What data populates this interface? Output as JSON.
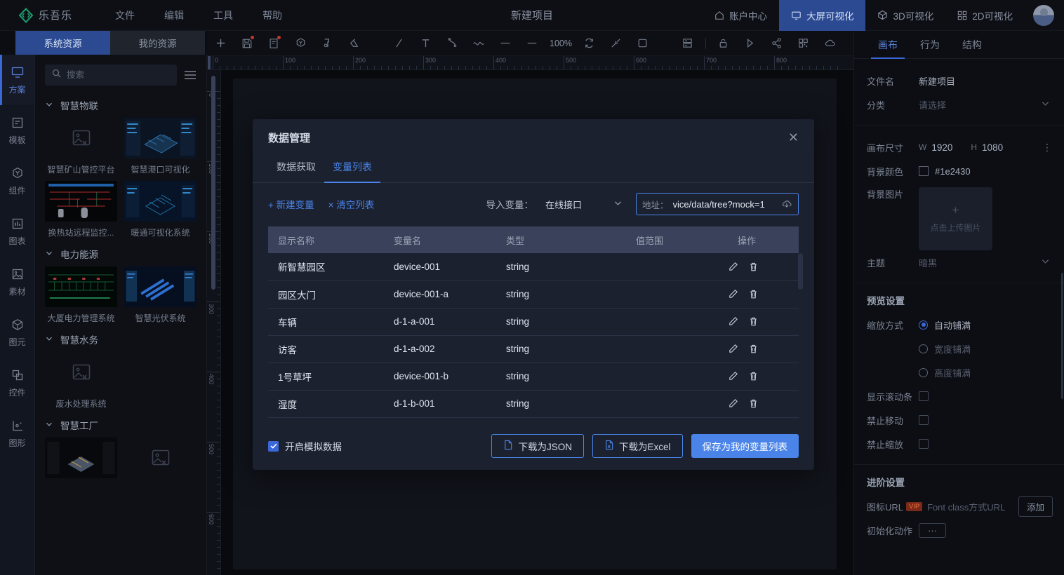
{
  "topbar": {
    "brand": "乐吾乐",
    "menu": [
      "文件",
      "编辑",
      "工具",
      "帮助"
    ],
    "project_title": "新建项目",
    "right_items": [
      {
        "label": "账户中心",
        "icon": "home-icon",
        "active": false
      },
      {
        "label": "大屏可视化",
        "icon": "monitor-icon",
        "active": true
      },
      {
        "label": "3D可视化",
        "icon": "cube-icon",
        "active": false
      },
      {
        "label": "2D可视化",
        "icon": "grid-icon",
        "active": false
      }
    ],
    "accent": "#2b4a92"
  },
  "left": {
    "tabs": [
      {
        "label": "系统资源",
        "active": true
      },
      {
        "label": "我的资源",
        "active": false
      }
    ],
    "rail": [
      {
        "label": "方案",
        "icon": "monitor-icon",
        "active": true
      },
      {
        "label": "模板",
        "icon": "template-icon",
        "active": false
      },
      {
        "label": "组件",
        "icon": "component-icon",
        "active": false
      },
      {
        "label": "图表",
        "icon": "chart-icon",
        "active": false
      },
      {
        "label": "素材",
        "icon": "image-icon",
        "active": false
      },
      {
        "label": "图元",
        "icon": "cube-icon",
        "active": false
      },
      {
        "label": "控件",
        "icon": "widget-icon",
        "active": false
      },
      {
        "label": "图形",
        "icon": "shape-icon",
        "active": false
      }
    ],
    "search_placeholder": "搜索",
    "search_value": "",
    "list_toggle_icon": "list-icon",
    "groups": [
      {
        "title": "智慧物联",
        "items": [
          {
            "label": "智慧矿山管控平台",
            "thumb": "broken"
          },
          {
            "label": "智慧港口可视化",
            "thumb": "port"
          },
          {
            "label": "换热站远程监控...",
            "thumb": "heat"
          },
          {
            "label": "暖通可视化系统",
            "thumb": "hvac"
          }
        ]
      },
      {
        "title": "电力能源",
        "items": [
          {
            "label": "大厦电力管理系统",
            "thumb": "power"
          },
          {
            "label": "智慧光伏系统",
            "thumb": "solar"
          }
        ]
      },
      {
        "title": "智慧水务",
        "items": [
          {
            "label": "废水处理系统",
            "thumb": "broken"
          }
        ]
      },
      {
        "title": "智慧工厂",
        "items": [
          {
            "label": "",
            "thumb": "factory"
          },
          {
            "label": "",
            "thumb": "broken"
          }
        ]
      }
    ]
  },
  "toolbar": {
    "zoom": "100%",
    "items": [
      {
        "icon": "plus-icon",
        "badge": false
      },
      {
        "icon": "save-icon",
        "badge": true
      },
      {
        "icon": "file-icon",
        "badge": true
      },
      {
        "icon": "component-icon",
        "badge": false
      },
      {
        "icon": "pen-node-icon",
        "badge": false
      },
      {
        "icon": "eraser-icon",
        "badge": false
      },
      {
        "icon": "line-icon",
        "badge": false
      },
      {
        "icon": "text-icon",
        "badge": false
      },
      {
        "icon": "curve-icon",
        "badge": false
      },
      {
        "icon": "wave-icon",
        "badge": false
      },
      {
        "icon": "dash-icon",
        "badge": false
      },
      {
        "icon": "minus-icon",
        "badge": false
      },
      {
        "icon": "refresh-icon",
        "badge": false
      },
      {
        "icon": "shrink-icon",
        "badge": false
      },
      {
        "icon": "square-icon",
        "badge": false
      },
      {
        "icon": "layers-icon",
        "badge": false
      },
      {
        "icon": "lock-icon",
        "badge": false
      },
      {
        "icon": "play-icon",
        "badge": false
      },
      {
        "icon": "share-icon",
        "badge": false
      },
      {
        "icon": "qrcode-icon",
        "badge": false
      },
      {
        "icon": "cloud-icon",
        "badge": false
      }
    ]
  },
  "rulers": {
    "horizontal": [
      "0",
      "100",
      "200",
      "300",
      "400",
      "500",
      "600",
      "700",
      "800"
    ],
    "vertical": [
      "0",
      "100",
      "200",
      "300",
      "400",
      "500",
      "600"
    ]
  },
  "modal": {
    "title": "数据管理",
    "close_icon": "close-icon",
    "tabs": [
      {
        "label": "数据获取",
        "active": false
      },
      {
        "label": "变量列表",
        "active": true
      }
    ],
    "new_var_link": "+ 新建变量",
    "clear_link": "× 清空列表",
    "import_label": "导入变量：",
    "import_select_value": "在线接口",
    "import_select_options": [
      "在线接口"
    ],
    "address_label": "地址：",
    "address_value": "vice/data/tree?mock=1",
    "download_icon": "download-cloud-icon",
    "table": {
      "headers": [
        "显示名称",
        "变量名",
        "类型",
        "值范围",
        "操作"
      ],
      "rows": [
        {
          "name": "新智慧园区",
          "var": "device-001",
          "type": "string",
          "range": ""
        },
        {
          "name": "园区大门",
          "var": "device-001-a",
          "type": "string",
          "range": ""
        },
        {
          "name": "车辆",
          "var": "d-1-a-001",
          "type": "string",
          "range": ""
        },
        {
          "name": "访客",
          "var": "d-1-a-002",
          "type": "string",
          "range": ""
        },
        {
          "name": "1号草坪",
          "var": "device-001-b",
          "type": "string",
          "range": ""
        },
        {
          "name": "湿度",
          "var": "d-1-b-001",
          "type": "string",
          "range": ""
        }
      ],
      "row_actions": [
        {
          "icon": "edit-pencil-icon"
        },
        {
          "icon": "trash-icon"
        }
      ]
    },
    "mock_checkbox": {
      "label": "开启模拟数据",
      "checked": true
    },
    "buttons": [
      {
        "label": "下载为JSON",
        "style": "ghost",
        "icon": "file-json-icon"
      },
      {
        "label": "下载为Excel",
        "style": "ghost",
        "icon": "file-excel-icon"
      },
      {
        "label": "保存为我的变量列表",
        "style": "primary",
        "icon": ""
      }
    ],
    "accent": "#4a84e8"
  },
  "right": {
    "tabs": [
      {
        "label": "画布",
        "active": true
      },
      {
        "label": "行为",
        "active": false
      },
      {
        "label": "结构",
        "active": false
      }
    ],
    "filename_label": "文件名",
    "filename_value": "新建项目",
    "category_label": "分类",
    "category_placeholder": "请选择",
    "canvas_size_label": "画布尺寸",
    "canvas_w_key": "W",
    "canvas_w": "1920",
    "canvas_h_key": "H",
    "canvas_h": "1080",
    "bgcolor_label": "背景颜色",
    "bgcolor_value": "#1e2430",
    "bgimage_label": "背景图片",
    "bgimage_plus": "+",
    "bgimage_hint": "点击上传图片",
    "theme_label": "主题",
    "theme_value": "暗黑",
    "preview_section": "预览设置",
    "scale_label": "缩放方式",
    "scale_options": [
      {
        "label": "自动铺满",
        "selected": true
      },
      {
        "label": "宽度铺满",
        "selected": false
      },
      {
        "label": "高度铺满",
        "selected": false
      }
    ],
    "toggles": [
      {
        "label": "显示滚动条",
        "checked": false
      },
      {
        "label": "禁止移动",
        "checked": false
      },
      {
        "label": "禁止缩放",
        "checked": false
      }
    ],
    "advanced_section": "进阶设置",
    "icon_url_label": "图标URL",
    "icon_url_badge": "VIP",
    "icon_url_placeholder": "Font class方式URL",
    "icon_url_button": "添加",
    "init_action_label": "初始化动作",
    "init_action_button": "···"
  }
}
